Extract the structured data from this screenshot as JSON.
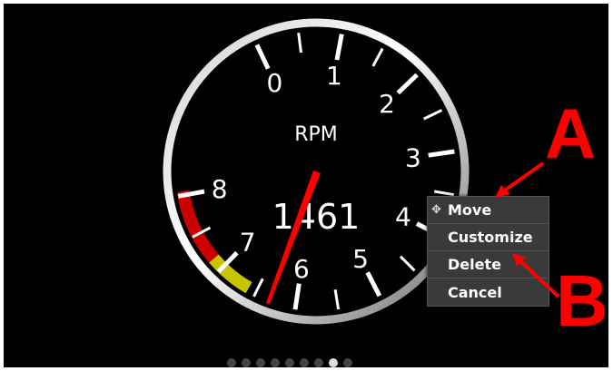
{
  "gauge": {
    "title": "RPM",
    "value": "1461",
    "dial_numbers": [
      "0",
      "1",
      "2",
      "3",
      "4",
      "5",
      "6",
      "7",
      "8"
    ]
  },
  "context_menu": {
    "items": [
      {
        "label": "Move",
        "icon": "move-arrows-icon"
      },
      {
        "label": "Customize"
      },
      {
        "label": "Delete"
      },
      {
        "label": "Cancel"
      }
    ]
  },
  "annotations": {
    "a": "A",
    "b": "B"
  },
  "page_indicator": {
    "count": 9,
    "active_index": 7
  },
  "colors": {
    "needle": "#ff0000",
    "warn_zone": "#c8c400",
    "red_zone": "#cc0000",
    "annotation": "#ff0000"
  }
}
